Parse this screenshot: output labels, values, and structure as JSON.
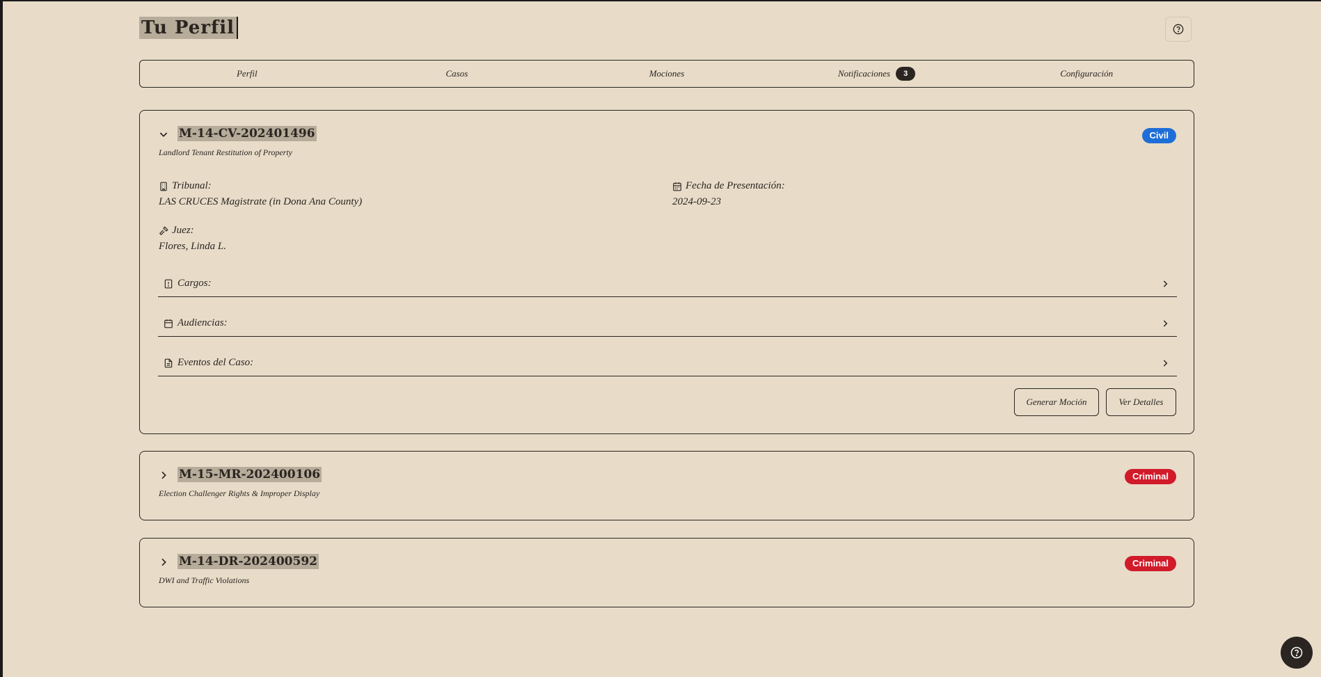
{
  "header": {
    "title": "Tu Perfil",
    "help_icon": "help-circle-icon"
  },
  "tabs": [
    {
      "label": "Perfil"
    },
    {
      "label": "Casos"
    },
    {
      "label": "Mociones"
    },
    {
      "label": "Notificaciones",
      "badge": "3"
    },
    {
      "label": "Configuración"
    }
  ],
  "cases": [
    {
      "id": "M-14-CV-202401496",
      "title": "Landlord Tenant Restitution of Property",
      "type": "Civil",
      "type_color": "#1e6ed8",
      "expanded": true,
      "court_label": "Tribunal:",
      "court_value": "LAS CRUCES Magistrate (in Dona Ana County)",
      "filing_label": "Fecha de Presentación:",
      "filing_value": "2024-09-23",
      "judge_label": "Juez:",
      "judge_value": "Flores, Linda L.",
      "sections": {
        "charges": "Cargos:",
        "hearings": "Audiencias:",
        "events": "Eventos del Caso:"
      },
      "actions": {
        "generate_motion": "Generar Moción",
        "view_details": "Ver Detalles"
      }
    },
    {
      "id": "M-15-MR-202400106",
      "title": "Election Challenger Rights & Improper Display",
      "type": "Criminal",
      "type_color": "#d11a2a",
      "expanded": false
    },
    {
      "id": "M-14-DR-202400592",
      "title": "DWI and Traffic Violations",
      "type": "Criminal",
      "type_color": "#d11a2a",
      "expanded": false
    }
  ],
  "colors": {
    "background": "#e8dcc9",
    "ink": "#2a2520",
    "civil": "#1e6ed8",
    "criminal": "#d11a2a"
  }
}
